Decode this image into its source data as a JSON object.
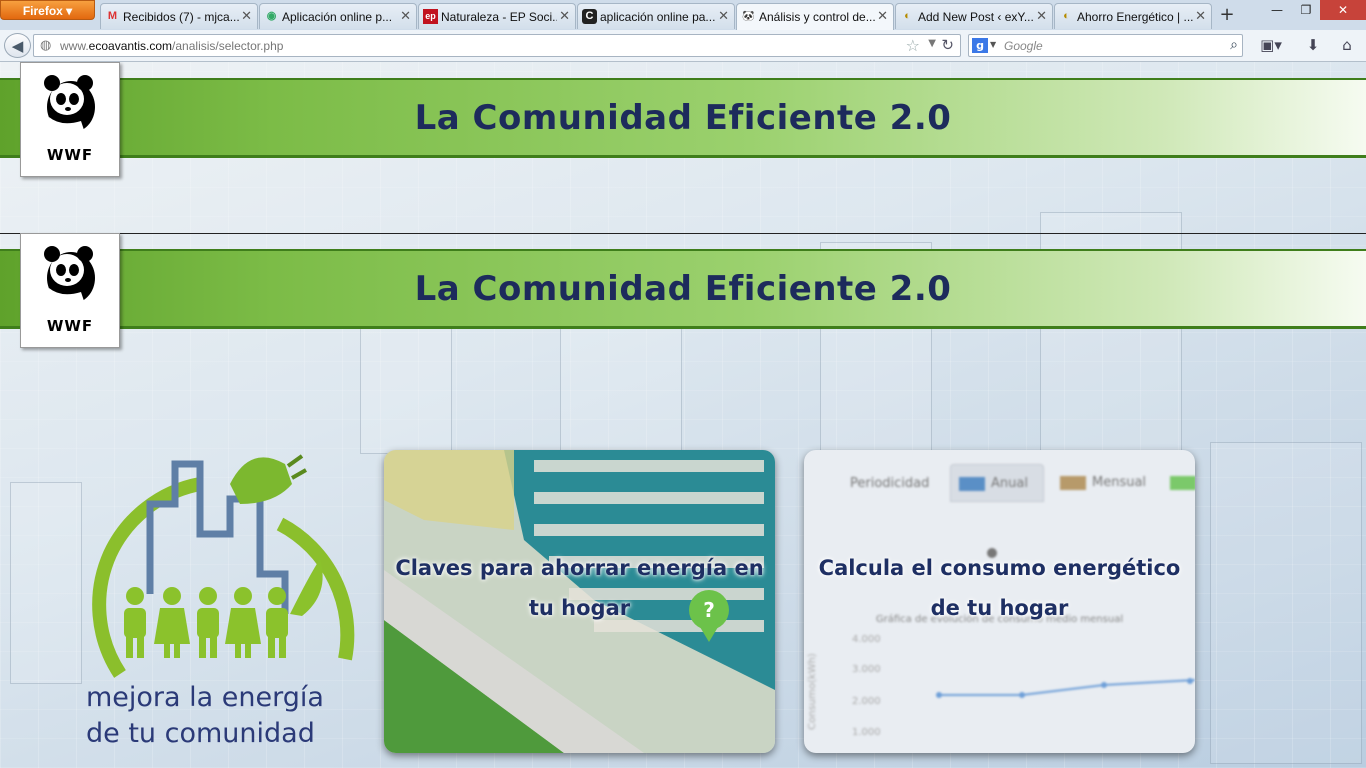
{
  "browser": {
    "app_button": "Firefox",
    "tabs": [
      {
        "favicon": "M",
        "title": "Recibidos (7) - mjca..."
      },
      {
        "favicon": "◉",
        "title": "Aplicación online p..."
      },
      {
        "favicon": "ep",
        "title": "Naturaleza - EP Soci..."
      },
      {
        "favicon": "C",
        "title": "aplicación online pa..."
      },
      {
        "favicon": "🐼",
        "title": "Análisis y control de..."
      },
      {
        "favicon": "◐",
        "title": "Add New Post ‹ exY..."
      },
      {
        "favicon": "◐",
        "title": "Ahorro Energético | ..."
      }
    ],
    "new_tab": "+",
    "window_controls": {
      "minimize": "—",
      "restore": "❐",
      "close": "✕"
    },
    "url_prefix": "www.",
    "url_domain": "ecoavantis.com",
    "url_path": "/analisis/selector.php",
    "search_placeholder": "Google",
    "search_engine_icon": "g"
  },
  "page": {
    "banner_title_1": "La Comunidad Eficiente 2.0",
    "banner_title_2": "La Comunidad Eficiente 2.0",
    "wwf_label": "WWF",
    "wwf_label_2": "WWF",
    "logo_line1": "mejora la energía",
    "logo_line2": "de tu comunidad",
    "cards": [
      {
        "caption": "Claves para ahorrar energía en tu hogar"
      },
      {
        "caption": "Calcula el consumo energético de tu hogar"
      }
    ],
    "card2_screenshot": {
      "tab_periodicidad": "Periodicidad",
      "tab_anual": "Anual",
      "tab_mensual": "Mensual",
      "chart_title": "Gráfica de evolución de consumo medio mensual",
      "ylabel": "Consumo(kWh)",
      "ticks": [
        "4.000",
        "3.000",
        "2.000",
        "1.000"
      ]
    }
  }
}
